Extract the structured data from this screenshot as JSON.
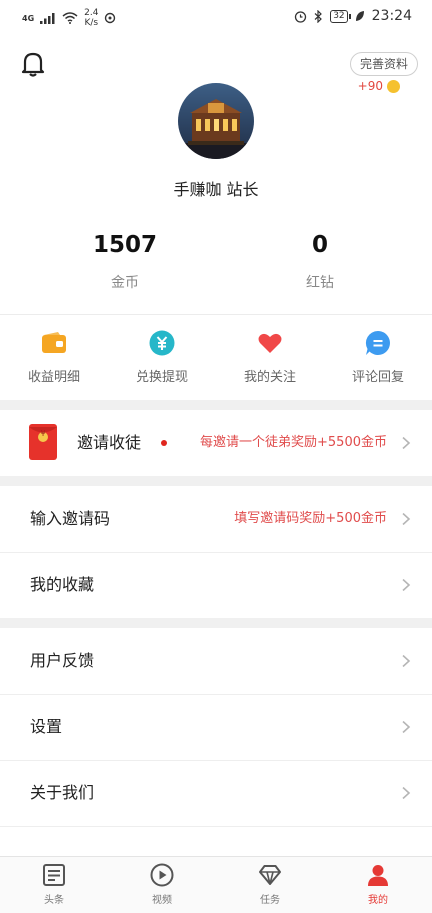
{
  "status_bar": {
    "signal_label": "4G",
    "net_speed_value": "2.4",
    "net_speed_unit": "K/s",
    "battery": "32",
    "time": "23:24"
  },
  "header": {
    "complete_profile_label": "完善资料",
    "bonus": "+90"
  },
  "profile": {
    "name": "手赚咖 站长"
  },
  "stats": [
    {
      "value": "1507",
      "label": "金币"
    },
    {
      "value": "0",
      "label": "红钻"
    }
  ],
  "quick_actions": [
    {
      "label": "收益明细",
      "icon": "wallet-icon",
      "color": "#f5a623"
    },
    {
      "label": "兑换提现",
      "icon": "yuan-exchange-icon",
      "color": "#26b7c9"
    },
    {
      "label": "我的关注",
      "icon": "heart-icon",
      "color": "#f04848"
    },
    {
      "label": "评论回复",
      "icon": "comment-icon",
      "color": "#3d9bf0"
    }
  ],
  "invite": {
    "title": "邀请收徒",
    "hint": "每邀请一个徒弟奖励+5500金币",
    "envelope_char": "¥"
  },
  "menu_group1": [
    {
      "title": "输入邀请码",
      "hint": "填写邀请码奖励+500金币"
    },
    {
      "title": "我的收藏",
      "hint": ""
    }
  ],
  "menu_group2": [
    {
      "title": "用户反馈"
    },
    {
      "title": "设置"
    },
    {
      "title": "关于我们"
    }
  ],
  "tabs": [
    {
      "label": "头条",
      "icon": "news-icon",
      "active": false
    },
    {
      "label": "视频",
      "icon": "play-icon",
      "active": false
    },
    {
      "label": "任务",
      "icon": "diamond-icon",
      "active": false
    },
    {
      "label": "我的",
      "icon": "user-icon",
      "active": true
    }
  ],
  "colors": {
    "accent_red": "#e53935",
    "hint_red": "#e04c4c",
    "coin_gold": "#f5c12f"
  }
}
